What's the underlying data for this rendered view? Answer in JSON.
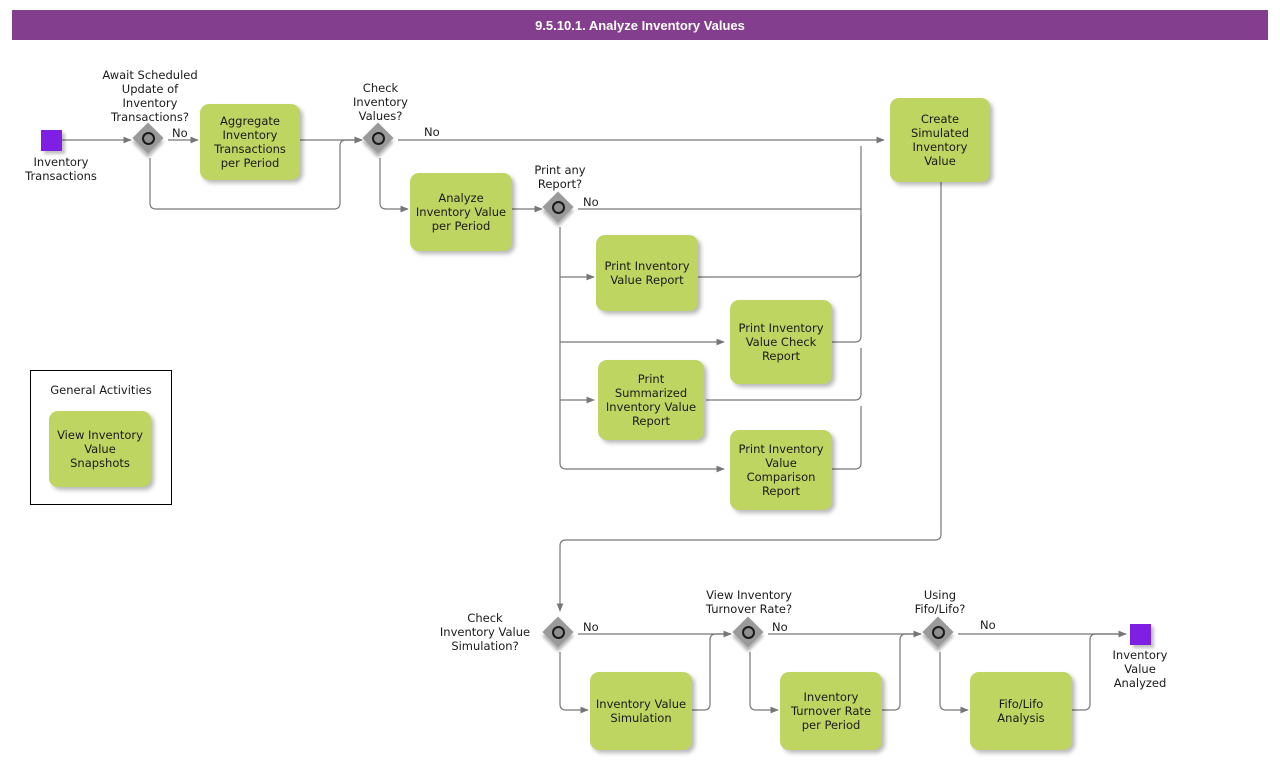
{
  "header": {
    "title": "9.5.10.1. Analyze Inventory Values",
    "bar_color": "#833F8E"
  },
  "palette": {
    "task_fill": "#BFD561",
    "event_fill": "#7E1FE3",
    "gateway_fill": "#9A9A9A",
    "line": "#666666",
    "text": "#1A1A1A"
  },
  "events": {
    "start": {
      "label": "Inventory\nTransactions",
      "name": "start-event"
    },
    "end": {
      "label": "Inventory\nValue\nAnalyzed",
      "name": "end-event"
    }
  },
  "gateways": [
    {
      "id": "gw1",
      "label": "Await Scheduled\nUpdate of\nInventory\nTransactions?",
      "branch_label": "No"
    },
    {
      "id": "gw2",
      "label": "Check\nInventory\nValues?",
      "branch_label": "No"
    },
    {
      "id": "gw3",
      "label": "Print any\nReport?",
      "branch_label": "No"
    },
    {
      "id": "gw4",
      "label": "Check\nInventory Value\nSimulation?",
      "branch_label": "No"
    },
    {
      "id": "gw5",
      "label": "View Inventory\nTurnover Rate?",
      "branch_label": "No"
    },
    {
      "id": "gw6",
      "label": "Using\nFifo/Lifo?",
      "branch_label": "No"
    }
  ],
  "tasks": [
    {
      "id": "t_aggregate",
      "label": "Aggregate\nInventory\nTransactions per\nPeriod"
    },
    {
      "id": "t_analyze",
      "label": "Analyze\nInventory Value\nper Period"
    },
    {
      "id": "t_create_sim",
      "label": "Create\nSimulated\nInventory Value"
    },
    {
      "id": "t_print_ivr",
      "label": "Print Inventory\nValue Report"
    },
    {
      "id": "t_print_check",
      "label": "Print Inventory\nValue Check\nReport"
    },
    {
      "id": "t_print_summ",
      "label": "Print\nSummarized\nInventory Value\nReport"
    },
    {
      "id": "t_print_comp",
      "label": "Print Inventory\nValue\nComparison\nReport"
    },
    {
      "id": "t_sim",
      "label": "Inventory\nValue\nSimulation"
    },
    {
      "id": "t_turnover",
      "label": "Inventory\nTurnover Rate\nper Period"
    },
    {
      "id": "t_fifolifo",
      "label": "Fifo/Lifo\nAnalysis"
    }
  ],
  "general_activities": {
    "title": "General Activities",
    "items": [
      {
        "id": "t_snapshots",
        "label": "View Inventory\nValue Snapshots"
      }
    ]
  }
}
